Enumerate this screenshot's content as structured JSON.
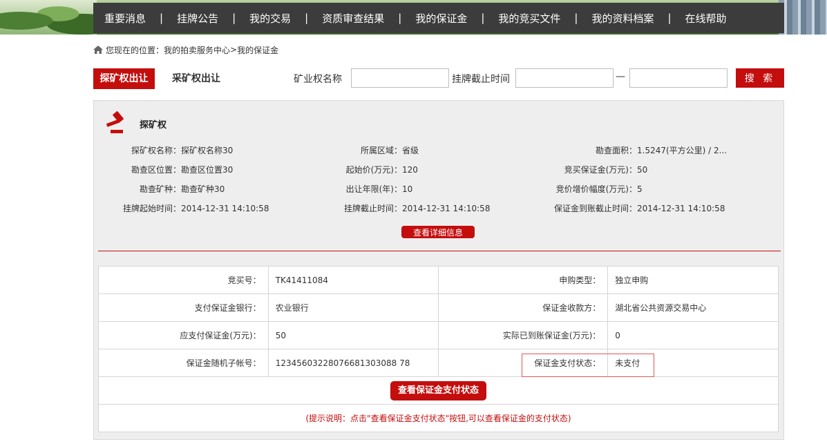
{
  "nav": [
    "重要消息",
    "挂牌公告",
    "我的交易",
    "资质审查结果",
    "我的保证金",
    "我的竞买文件",
    "我的资料档案",
    "在线帮助"
  ],
  "nav_sep": "|",
  "breadcrumb": {
    "prefix": "您现在的位置：",
    "level1": "我的拍卖服务中心",
    "arrow": " > ",
    "level2": "我的保证金"
  },
  "tabs": {
    "active": "探矿权出让",
    "other": "采矿权出让"
  },
  "search": {
    "name_label": "矿业权名称",
    "name_value": "",
    "deadline_label": "挂牌截止时间",
    "date_from": "",
    "dash": "—",
    "date_to": "",
    "button": "搜 索"
  },
  "section": {
    "title": "探矿权",
    "rows": [
      [
        {
          "k": "探矿权名称：",
          "v": "探矿权名称30"
        },
        {
          "k": "所属区域：",
          "v": "省级"
        },
        {
          "k": "勘查面积：",
          "v": "1.5247(平方公里) / 2..."
        }
      ],
      [
        {
          "k": "勘查区位置：",
          "v": "勘查区位置30"
        },
        {
          "k": "起始价(万元)：",
          "v": "120"
        },
        {
          "k": "竞买保证金(万元)：",
          "v": "50"
        }
      ],
      [
        {
          "k": "勘查矿种：",
          "v": "勘查矿种30"
        },
        {
          "k": "出让年限(年)：",
          "v": "10"
        },
        {
          "k": "竞价增价幅度(万元)：",
          "v": "5"
        }
      ],
      [
        {
          "k": "挂牌起始时间：",
          "v": "2014-12-31 14:10:58"
        },
        {
          "k": "挂牌截止时间：",
          "v": "2014-12-31 14:10:58"
        },
        {
          "k": "保证金到账截止时间：",
          "v": "2014-12-31 14:10:58"
        }
      ]
    ],
    "detail_button": "查看详细信息"
  },
  "table": {
    "rows": [
      [
        "竞买号：",
        "TK41411084",
        "申购类型：",
        "独立申购"
      ],
      [
        "支付保证金银行：",
        "农业银行",
        "保证金收款方：",
        "湖北省公共资源交易中心"
      ],
      [
        "应支付保证金(万元)：",
        "50",
        "实际已到账保证金(万元)：",
        "0"
      ],
      [
        "保证金随机子帐号：",
        "12345603228076681303088 78",
        "保证金支付状态：",
        "未支付"
      ]
    ],
    "pay_button": "查看保证金支付状态",
    "hint": "(提示说明：点击\"查看保证金支付状态\"按钮,可以查看保证金的支付状态)"
  },
  "colors": {
    "accent": "#c40d0d",
    "nav_bg": "#3c3c3c",
    "panel_bg": "#eeeeee"
  }
}
